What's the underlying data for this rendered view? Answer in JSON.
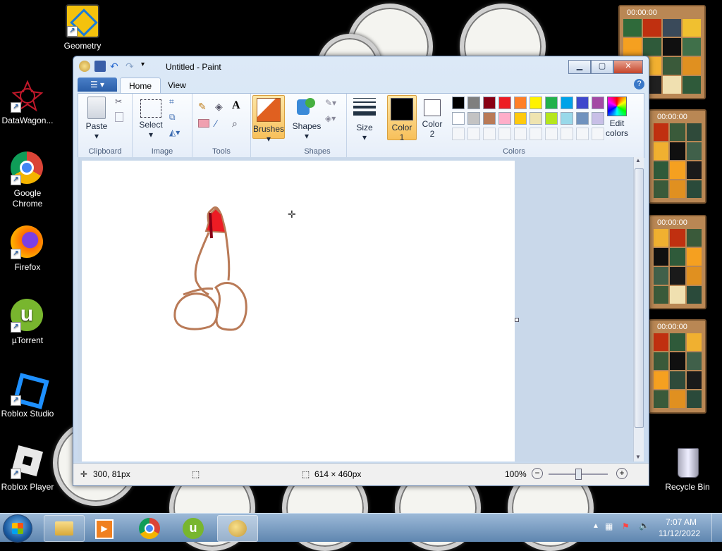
{
  "desktop": {
    "icons": [
      {
        "label": "Geometry"
      },
      {
        "label": "DataWagon..."
      },
      {
        "label": "Google Chrome"
      },
      {
        "label": "Firefox"
      },
      {
        "label": "µTorrent"
      },
      {
        "label": "Roblox Studio"
      },
      {
        "label": "Roblox Player"
      },
      {
        "label": "Recycle Bin"
      }
    ]
  },
  "puzzles": [
    {
      "timer": "00:00:00"
    },
    {
      "timer": "00:00:00"
    },
    {
      "timer": "00:00:00"
    },
    {
      "timer": "00:00:00"
    }
  ],
  "paint": {
    "title": "Untitled - Paint",
    "tabs": {
      "home": "Home",
      "view": "View"
    },
    "groups": {
      "clipboard": "Clipboard",
      "image": "Image",
      "tools": "Tools",
      "shapes": "Shapes",
      "colors": "Colors"
    },
    "buttons": {
      "paste": "Paste",
      "select": "Select",
      "brushes": "Brushes",
      "shapes": "Shapes",
      "size": "Size",
      "color1": "Color 1",
      "color2": "Color 2",
      "edit_colors": "Edit colors"
    },
    "palette_row1": [
      "#000000",
      "#7f7f7f",
      "#880015",
      "#ed1c24",
      "#ff7f27",
      "#fff200",
      "#22b14c",
      "#00a2e8",
      "#3f48cc",
      "#a349a4"
    ],
    "palette_row2": [
      "#ffffff",
      "#c3c3c3",
      "#b97a57",
      "#ffaec9",
      "#ffc90e",
      "#efe4b0",
      "#b5e61d",
      "#99d9ea",
      "#7092be",
      "#c8bfe7"
    ],
    "color1_value": "#000000",
    "color2_value": "#ffffff",
    "status": {
      "cursor_pos": "300, 81px",
      "image_size": "614 × 460px",
      "zoom": "100%"
    }
  },
  "taskbar": {
    "time": "7:07 AM",
    "date": "11/12/2022"
  }
}
